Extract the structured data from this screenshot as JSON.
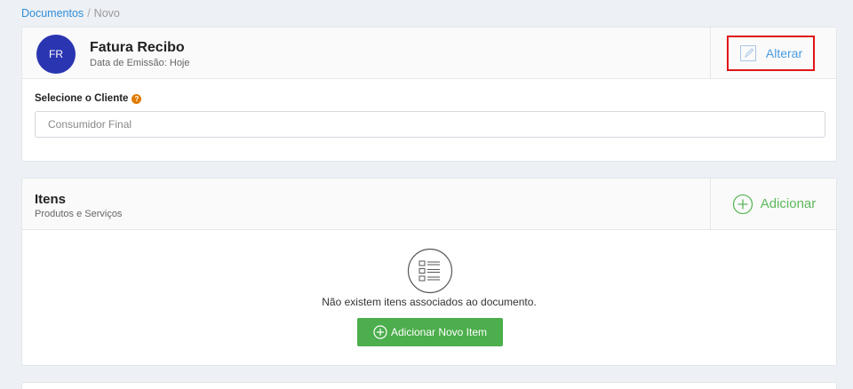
{
  "breadcrumb": {
    "root": "Documentos",
    "separator": "/",
    "current": "Novo"
  },
  "document": {
    "avatar": "FR",
    "title": "Fatura Recibo",
    "subtitle": "Data de Emissão: Hoje",
    "alter_label": "Alterar"
  },
  "client": {
    "label": "Selecione o Cliente",
    "help_icon": "?",
    "placeholder": "Consumidor Final"
  },
  "items": {
    "title": "Itens",
    "subtitle": "Produtos e Serviços",
    "add_label": "Adicionar",
    "empty_text": "Não existem itens associados ao documento.",
    "new_item_label": "Adicionar Novo Item"
  },
  "colors": {
    "accent_blue": "#4a9be0",
    "green": "#4cae4c",
    "avatar": "#2a35b1",
    "highlight": "#e01616"
  },
  "icons": [
    "edit-icon",
    "help-icon",
    "plus-circle-icon",
    "list-icon"
  ]
}
